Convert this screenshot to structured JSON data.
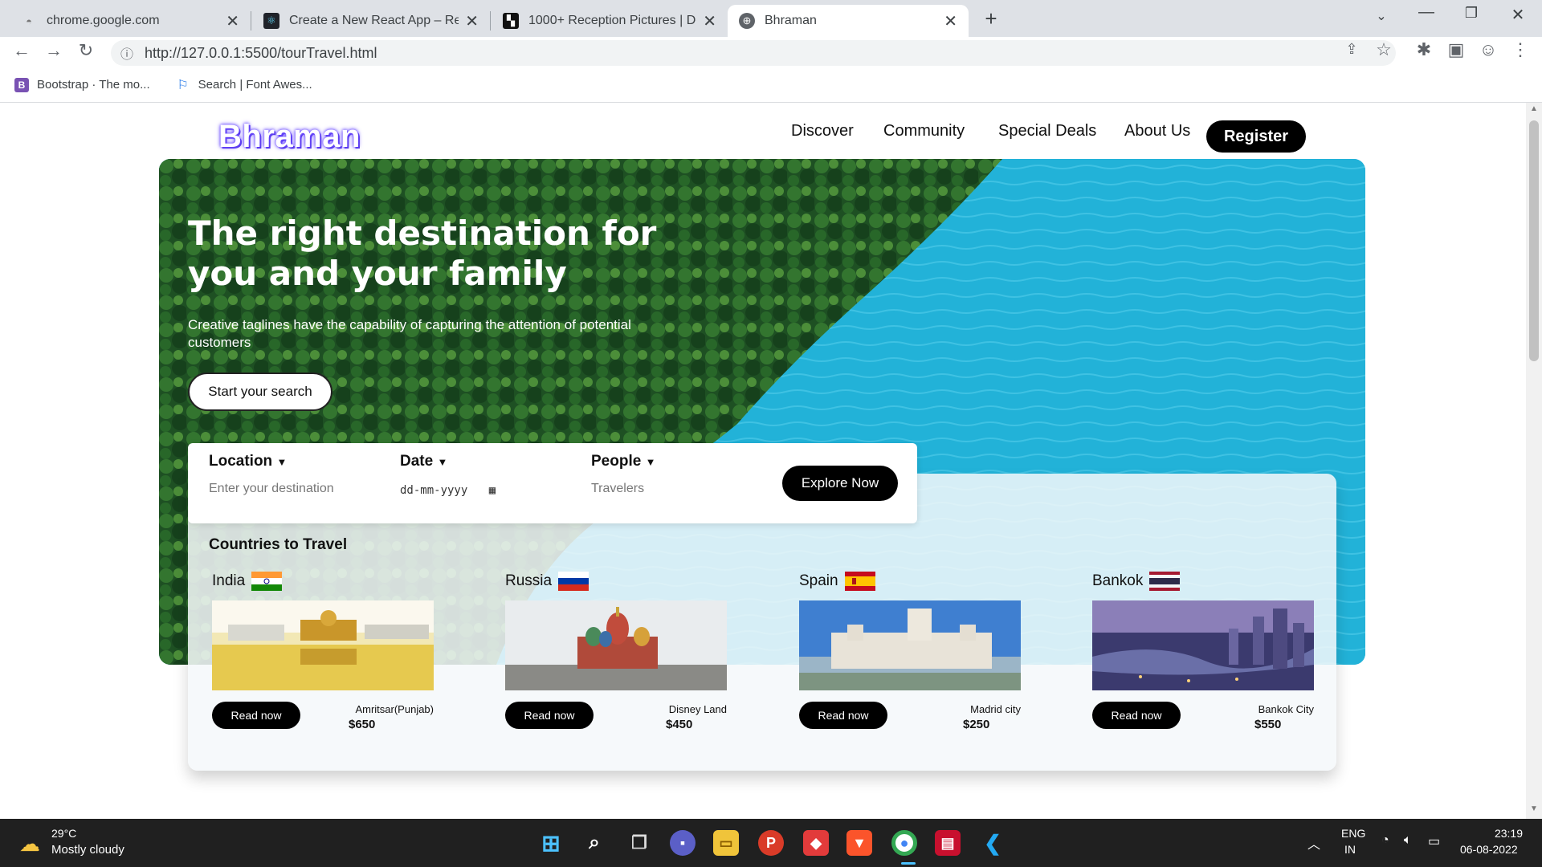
{
  "browser": {
    "tabs": [
      {
        "title": "chrome.google.com",
        "active": false
      },
      {
        "title": "Create a New React App – React",
        "active": false
      },
      {
        "title": "1000+ Reception Pictures | Down",
        "active": false
      },
      {
        "title": "Bhraman",
        "active": true
      }
    ],
    "url": "http://127.0.0.1:5500/tourTravel.html",
    "bookmarks": [
      {
        "label": "Bootstrap · The mo..."
      },
      {
        "label": "Search | Font Awes..."
      }
    ]
  },
  "site": {
    "logo": "Bhraman",
    "nav": [
      "Discover",
      "Community",
      "Special Deals",
      "About Us"
    ],
    "register": "Register"
  },
  "hero": {
    "title": "The right destination for you and your family",
    "subtitle": "Creative taglines have the capability of capturing the attention of potential customers",
    "cta": "Start your search"
  },
  "search": {
    "location_label": "Location",
    "location_placeholder": "Enter your destination",
    "date_label": "Date",
    "date_placeholder": "dd-mm-yyyy",
    "people_label": "People",
    "people_placeholder": "Travelers",
    "button": "Explore Now"
  },
  "countries": {
    "title": "Countries to Travel",
    "items": [
      {
        "name": "India",
        "place": "Amritsar(Punjab)",
        "price": "$650",
        "read": "Read now"
      },
      {
        "name": "Russia",
        "place": "Disney Land",
        "price": "$450",
        "read": "Read now"
      },
      {
        "name": "Spain",
        "place": "Madrid city",
        "price": "$250",
        "read": "Read now"
      },
      {
        "name": "Bankok",
        "place": "Bankok City",
        "price": "$550",
        "read": "Read now"
      }
    ]
  },
  "taskbar": {
    "temperature": "29°C",
    "weather": "Mostly cloudy",
    "lang": "ENG",
    "region": "IN",
    "time": "23:19",
    "date": "06-08-2022"
  }
}
